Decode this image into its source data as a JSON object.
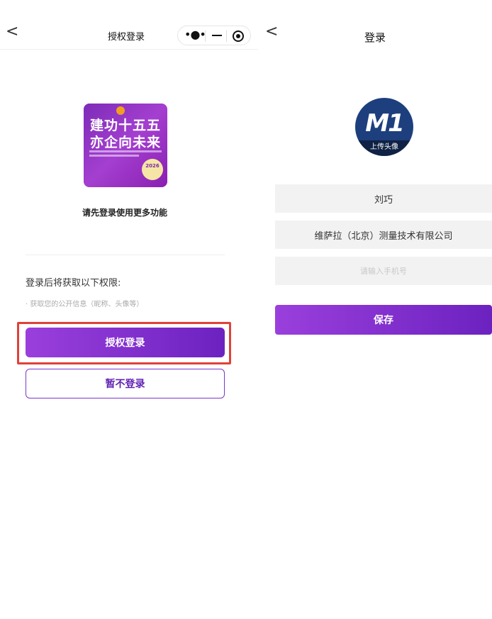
{
  "left": {
    "nav": {
      "back": "<",
      "title": "授权登录"
    },
    "capsule": {
      "more": "•●•"
    },
    "logo": {
      "line1": "建功十五五",
      "line2": "亦企向未来",
      "year": "2026"
    },
    "prompt": "请先登录使用更多功能",
    "permissions_title": "登录后将获取以下权限:",
    "permission_item": "· 获取您的公开信息（昵称、头像等）",
    "authorize_button": "授权登录",
    "skip_button": "暂不登录",
    "highlight_color": "#e0413a"
  },
  "right": {
    "nav": {
      "back": "<",
      "title": "登录"
    },
    "avatar": {
      "glyph": "M1",
      "label": "上传头像"
    },
    "name": "刘巧",
    "company": "维萨拉（北京）测量技术有限公司",
    "phone_placeholder": "请输入手机号",
    "save_button": "保存"
  },
  "colors": {
    "accent_start": "#9a3fdc",
    "accent_end": "#6c22c0"
  }
}
